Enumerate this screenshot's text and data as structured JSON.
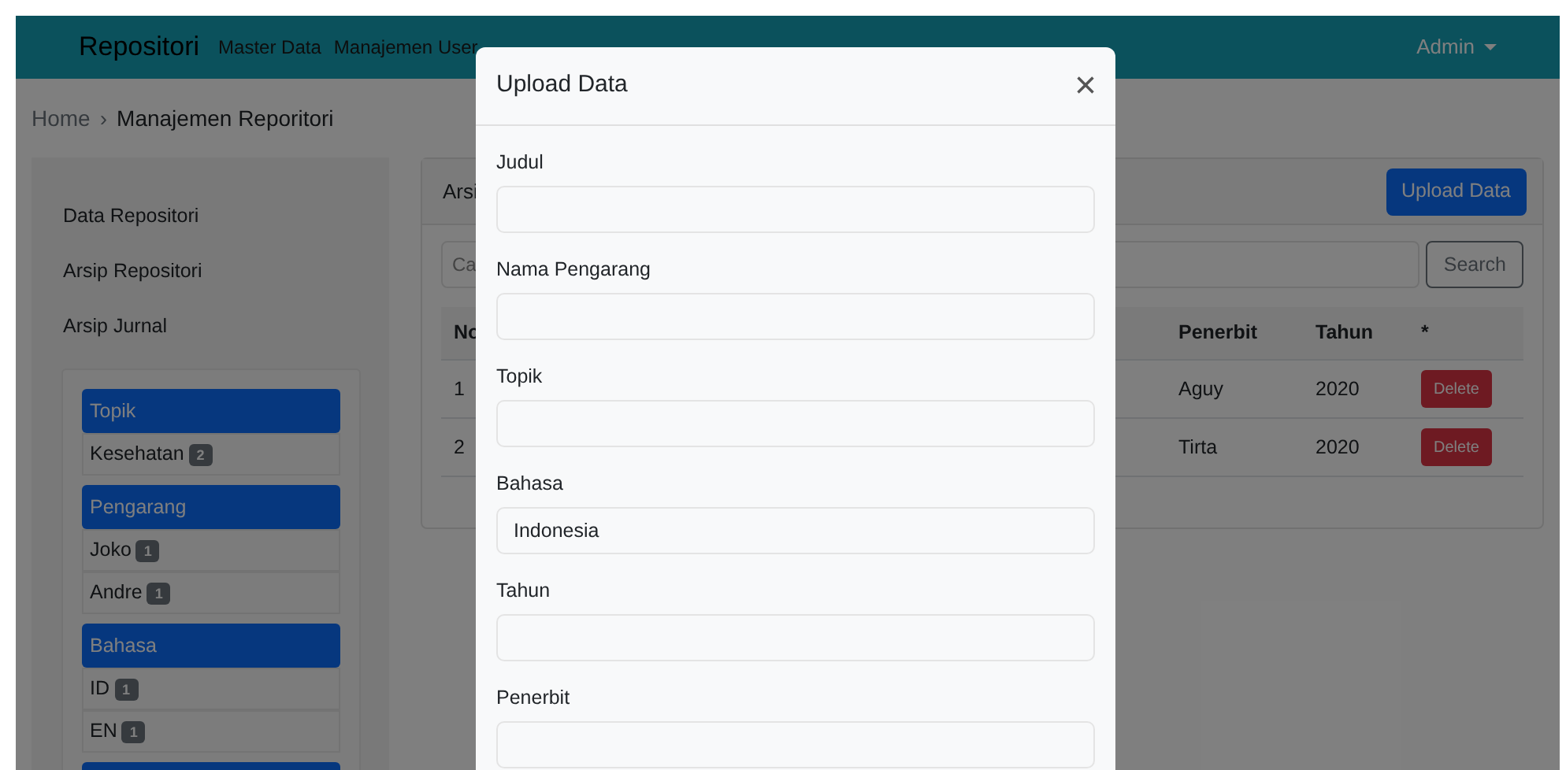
{
  "navbar": {
    "brand": "Repositori",
    "links": [
      "Master Data",
      "Manajemen User"
    ],
    "user_menu": "Admin"
  },
  "breadcrumb": {
    "items": [
      "Home",
      "Manajemen Reporitori"
    ],
    "separator": "›"
  },
  "sidebar": {
    "items": [
      "Data Repositori",
      "Arsip Repositori",
      "Arsip Jurnal"
    ],
    "groups": [
      {
        "title": "Topik",
        "entries": [
          {
            "label": "Kesehatan",
            "count": "2"
          }
        ]
      },
      {
        "title": "Pengarang",
        "entries": [
          {
            "label": "Joko",
            "count": "1"
          },
          {
            "label": "Andre",
            "count": "1"
          }
        ]
      },
      {
        "title": "Bahasa",
        "entries": [
          {
            "label": "ID",
            "count": "1"
          },
          {
            "label": "EN",
            "count": "1"
          }
        ]
      }
    ]
  },
  "main": {
    "card_title": "Arsi",
    "upload_button": "Upload Data",
    "search_placeholder": "Ca",
    "search_button": "Search",
    "table": {
      "columns": [
        "No",
        "Penerbit",
        "Tahun",
        "*"
      ],
      "rows": [
        {
          "no": "1",
          "penerbit": "Aguy",
          "tahun": "2020",
          "action": "Delete"
        },
        {
          "no": "2",
          "penerbit": "Tirta",
          "tahun": "2020",
          "action": "Delete"
        }
      ]
    }
  },
  "modal": {
    "title": "Upload Data",
    "close": "×",
    "fields": [
      {
        "label": "Judul"
      },
      {
        "label": "Nama Pengarang"
      },
      {
        "label": "Topik"
      },
      {
        "label": "Bahasa",
        "value": "Indonesia"
      },
      {
        "label": "Tahun"
      },
      {
        "label": "Penerbit"
      }
    ]
  }
}
